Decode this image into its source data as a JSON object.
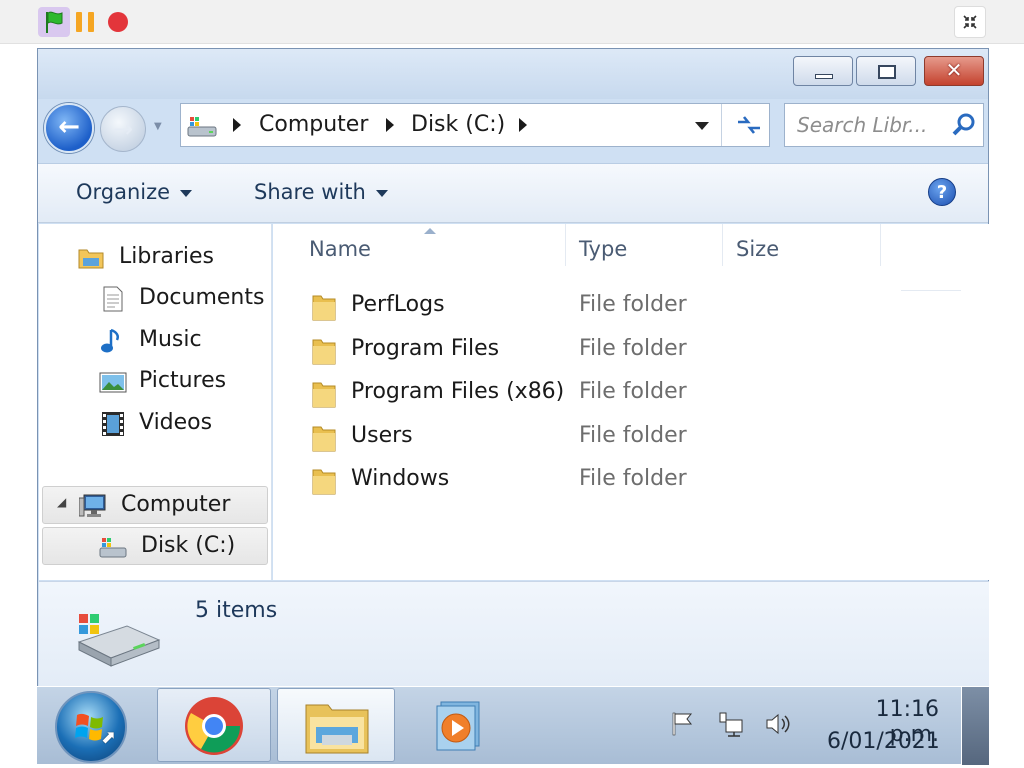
{
  "toolbar": {
    "flag_icon": "green-flag-icon",
    "pause_icon": "pause-icon",
    "stop_icon": "stop-icon",
    "shrink_icon": "shrink-icon",
    "colors": {
      "flag": "#2eb82e",
      "pause": "#f5a623",
      "stop": "#e3353b"
    }
  },
  "window": {
    "controls": {
      "close_label": "✕"
    },
    "address": {
      "crumbs": [
        "Computer",
        "Disk (C:)"
      ]
    },
    "search": {
      "placeholder": "Search Libr..."
    },
    "commands": {
      "organize": "Organize",
      "share_with": "Share with"
    },
    "nav": {
      "libraries": "Libraries",
      "documents": "Documents",
      "music": "Music",
      "pictures": "Pictures",
      "videos": "Videos",
      "computer": "Computer",
      "disk": "Disk (C:)"
    },
    "columns": {
      "name": "Name",
      "type": "Type",
      "size": "Size"
    },
    "files": [
      {
        "name": "PerfLogs",
        "type": "File folder"
      },
      {
        "name": "Program Files",
        "type": "File folder"
      },
      {
        "name": "Program Files (x86)",
        "type": "File folder"
      },
      {
        "name": "Users",
        "type": "File folder"
      },
      {
        "name": "Windows",
        "type": "File folder"
      }
    ],
    "details": {
      "count": "5 items"
    }
  },
  "taskbar": {
    "time": "11:16 p.m.",
    "date": "6/01/2021",
    "apps": [
      "chrome-icon",
      "explorer-icon",
      "media-player-icon"
    ]
  }
}
